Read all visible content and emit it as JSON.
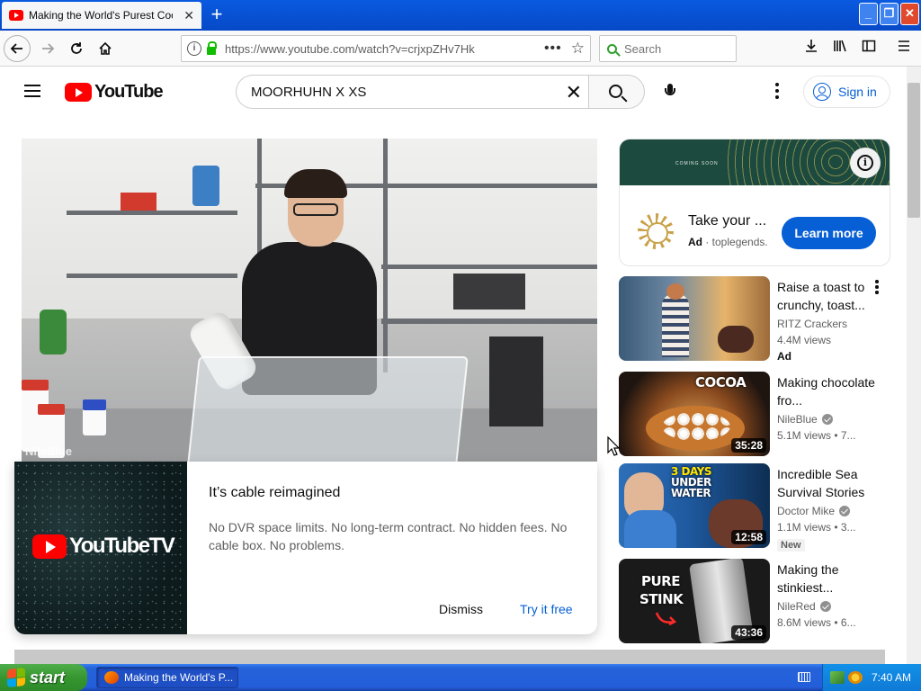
{
  "browser": {
    "tab_title": "Making the World's Purest Cookie",
    "tab_close": "✕",
    "new_tab": "+",
    "url": "https://www.youtube.com/watch?v=crjxpZHv7Hk",
    "url_actions": "•••",
    "search_placeholder": "Search",
    "window_controls": {
      "minimize": "_",
      "maximize": "❐",
      "close": "✕"
    }
  },
  "youtube": {
    "logo_text": "YouTube",
    "search_query": "MOORHUHN X XS",
    "sign_in": "Sign in"
  },
  "player": {
    "watermark": "NileBlue"
  },
  "promo": {
    "logo_text": "YouTubeTV",
    "title": "It’s cable reimagined",
    "body": "No DVR space limits. No long-term contract. No hidden fees. No cable box. No problems.",
    "dismiss": "Dismiss",
    "try": "Try it free"
  },
  "ad": {
    "banner_text": "COMING SOON",
    "title": "Take your ...",
    "badge": "Ad",
    "advertiser": "toplegends.",
    "cta": "Learn more"
  },
  "recommendations": [
    {
      "title": "Raise a toast to crunchy, toast...",
      "channel": "RITZ Crackers",
      "views": "4.4M views",
      "badge": "Ad",
      "duration": "",
      "verified": false
    },
    {
      "title": "Making chocolate fro...",
      "channel": "NileBlue",
      "views": "5.1M views  •  7...",
      "duration": "35:28",
      "thumb_text": "COCOA",
      "verified": true
    },
    {
      "title": "Incredible Sea Survival Stories",
      "channel": "Doctor Mike",
      "views": "1.1M views  •  3...",
      "duration": "12:58",
      "thumb_text_1": "3 DAYS",
      "thumb_text_2": "UNDER",
      "thumb_text_3": "WATER",
      "new_label": "New",
      "verified": true
    },
    {
      "title": "Making the stinkiest...",
      "channel": "NileRed",
      "views": "8.6M views  •  6...",
      "duration": "43:36",
      "thumb_text_1": "PURE",
      "thumb_text_2": "STINK",
      "verified": true
    }
  ],
  "taskbar": {
    "start": "start",
    "window_title": "Making the World's P...",
    "clock": "7:40 AM"
  },
  "colors": {
    "yt_red": "#ff0000",
    "yt_blue": "#065fd4",
    "xp_blue": "#245edb",
    "xp_green": "#37962f"
  }
}
